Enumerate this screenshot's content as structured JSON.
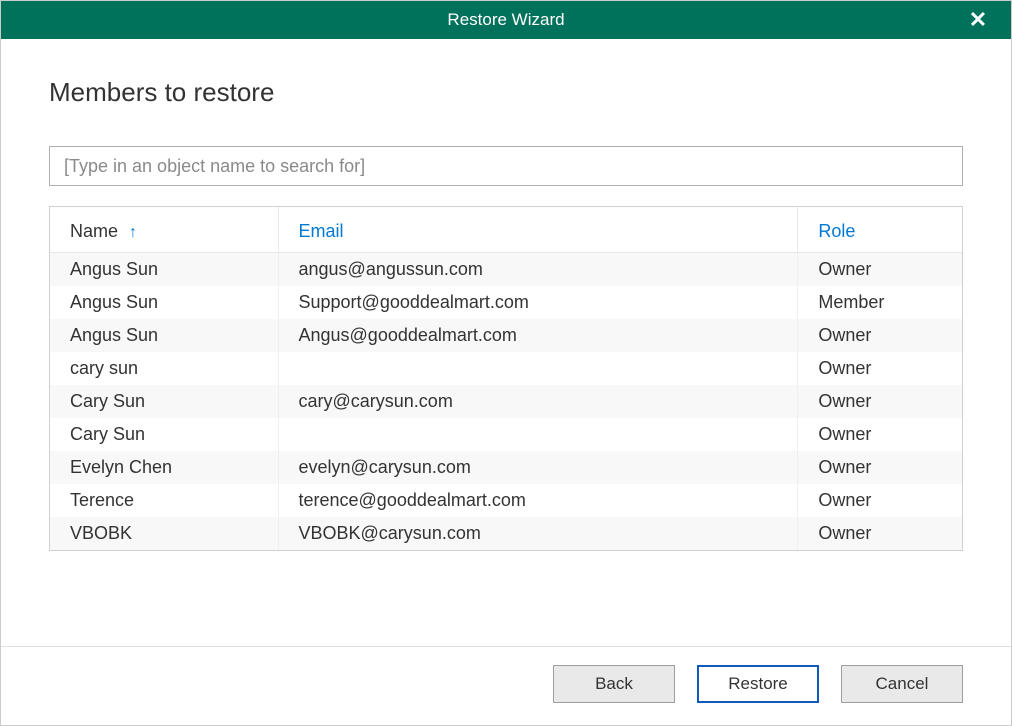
{
  "titlebar": {
    "title": "Restore Wizard",
    "close": "✕"
  },
  "heading": "Members to restore",
  "search": {
    "placeholder": "[Type in an object name to search for]"
  },
  "table": {
    "columns": {
      "name": "Name",
      "email": "Email",
      "role": "Role"
    },
    "sort_indicator": "↑",
    "rows": [
      {
        "name": "Angus Sun",
        "email": "angus@angussun.com",
        "role": "Owner"
      },
      {
        "name": "Angus Sun",
        "email": "Support@gooddealmart.com",
        "role": "Member"
      },
      {
        "name": "Angus Sun",
        "email": "Angus@gooddealmart.com",
        "role": "Owner"
      },
      {
        "name": "cary sun",
        "email": "",
        "role": "Owner"
      },
      {
        "name": "Cary Sun",
        "email": "cary@carysun.com",
        "role": "Owner"
      },
      {
        "name": "Cary Sun",
        "email": "",
        "role": "Owner"
      },
      {
        "name": "Evelyn Chen",
        "email": "evelyn@carysun.com",
        "role": "Owner"
      },
      {
        "name": "Terence",
        "email": "terence@gooddealmart.com",
        "role": "Owner"
      },
      {
        "name": "VBOBK",
        "email": "VBOBK@carysun.com",
        "role": "Owner"
      }
    ]
  },
  "footer": {
    "back": "Back",
    "restore": "Restore",
    "cancel": "Cancel"
  }
}
